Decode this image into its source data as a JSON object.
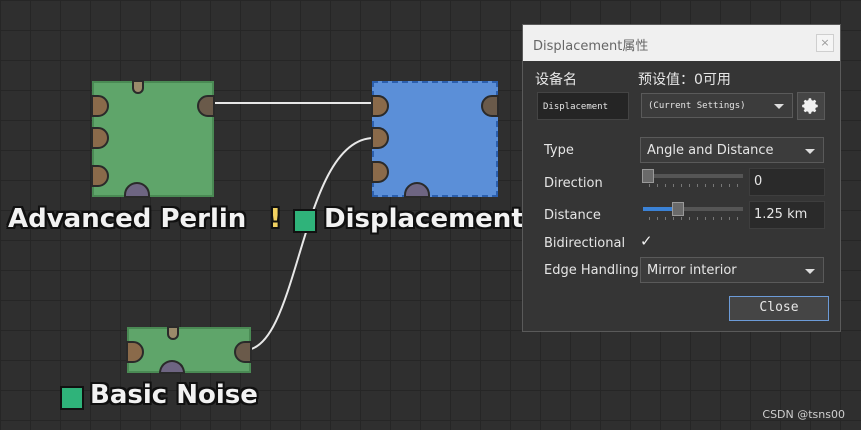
{
  "graph": {
    "nodes": {
      "advanced_perlin": {
        "title": "Advanced Perlin",
        "warning": "!"
      },
      "displacement": {
        "title": "Displacement"
      },
      "basic_noise": {
        "title": "Basic Noise"
      }
    }
  },
  "dialog": {
    "title": "Displacement属性",
    "close_x": "×",
    "device_name_label": "设备名",
    "device_name_value": "Displacement",
    "preset_label": "预设值：0可用",
    "preset_value": "(Current Settings)",
    "settings_icon": "gear-icon",
    "type": {
      "label": "Type",
      "value": "Angle and Distance"
    },
    "direction": {
      "label": "Direction",
      "value": "0",
      "slider_fraction": 0.0
    },
    "distance": {
      "label": "Distance",
      "value": "1.25 km",
      "slider_fraction": 0.35
    },
    "bidirectional": {
      "label": "Bidirectional",
      "checked": true,
      "mark": "✓"
    },
    "edge_handling": {
      "label": "Edge Handling",
      "value": "Mirror interior"
    },
    "close_button": "Close"
  },
  "watermark": "CSDN @tsns00",
  "colors": {
    "canvas": "#2f2f2f",
    "node_green": "#5fa56a",
    "node_blue": "#5b8fd8",
    "swatch_green": "#2fb37a",
    "accent_blue": "#3b82d6"
  }
}
